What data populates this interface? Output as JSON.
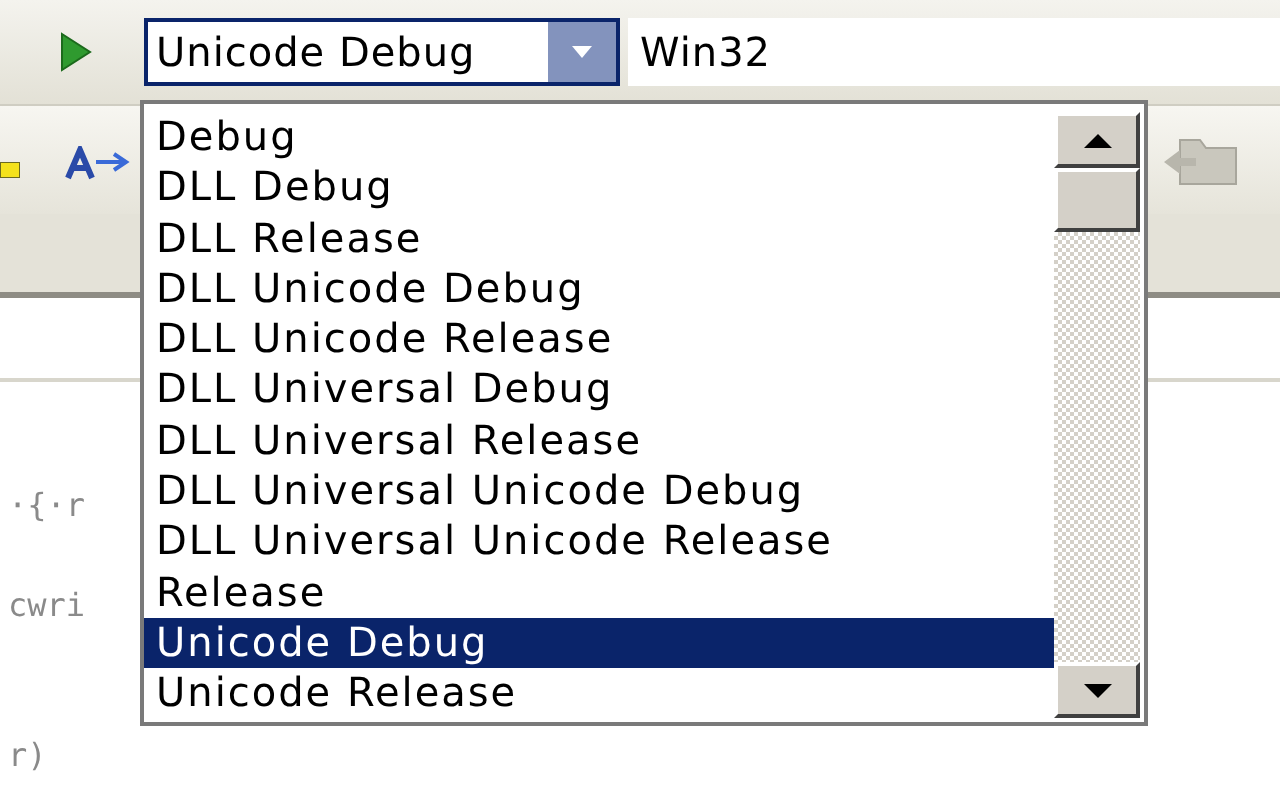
{
  "toolbar": {
    "configuration": {
      "value": "Unicode Debug",
      "expanded": true
    },
    "platform": {
      "value": "Win32"
    }
  },
  "dropdown": {
    "items": [
      {
        "label": "Debug",
        "selected": false
      },
      {
        "label": "DLL Debug",
        "selected": false
      },
      {
        "label": "DLL Release",
        "selected": false
      },
      {
        "label": "DLL Unicode Debug",
        "selected": false
      },
      {
        "label": "DLL Unicode Release",
        "selected": false
      },
      {
        "label": "DLL Universal Debug",
        "selected": false
      },
      {
        "label": "DLL Universal Release",
        "selected": false
      },
      {
        "label": "DLL Universal Unicode Debug",
        "selected": false
      },
      {
        "label": "DLL Universal Unicode Release",
        "selected": false
      },
      {
        "label": "Release",
        "selected": false
      },
      {
        "label": "Unicode Debug",
        "selected": true
      },
      {
        "label": "Unicode Release",
        "selected": false
      }
    ]
  },
  "editor": {
    "lines": [
      "·{·r",
      "cwri",
      "r)"
    ]
  }
}
